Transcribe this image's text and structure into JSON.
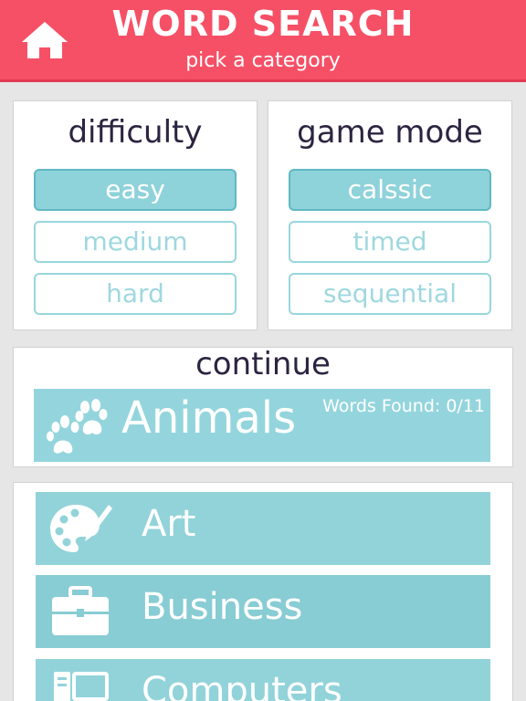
{
  "header": {
    "title": "WORD SEARCH",
    "subtitle": "pick a category"
  },
  "difficulty": {
    "title": "difficulty",
    "options": [
      "easy",
      "medium",
      "hard"
    ],
    "selected": "easy"
  },
  "game_mode": {
    "title": "game mode",
    "options": [
      "calssic",
      "timed",
      "sequential"
    ],
    "selected": "calssic"
  },
  "continue": {
    "title": "continue",
    "category": "Animals",
    "words_found": "Words Found: 0/11",
    "icon": "paw-icon"
  },
  "categories": [
    {
      "label": "Art",
      "icon": "palette-icon"
    },
    {
      "label": "Business",
      "icon": "briefcase-icon"
    },
    {
      "label": "Computers",
      "icon": "computer-icon"
    }
  ],
  "colors": {
    "header": "#f65066",
    "tile": "#92d3da",
    "text_dark": "#2c2440"
  }
}
